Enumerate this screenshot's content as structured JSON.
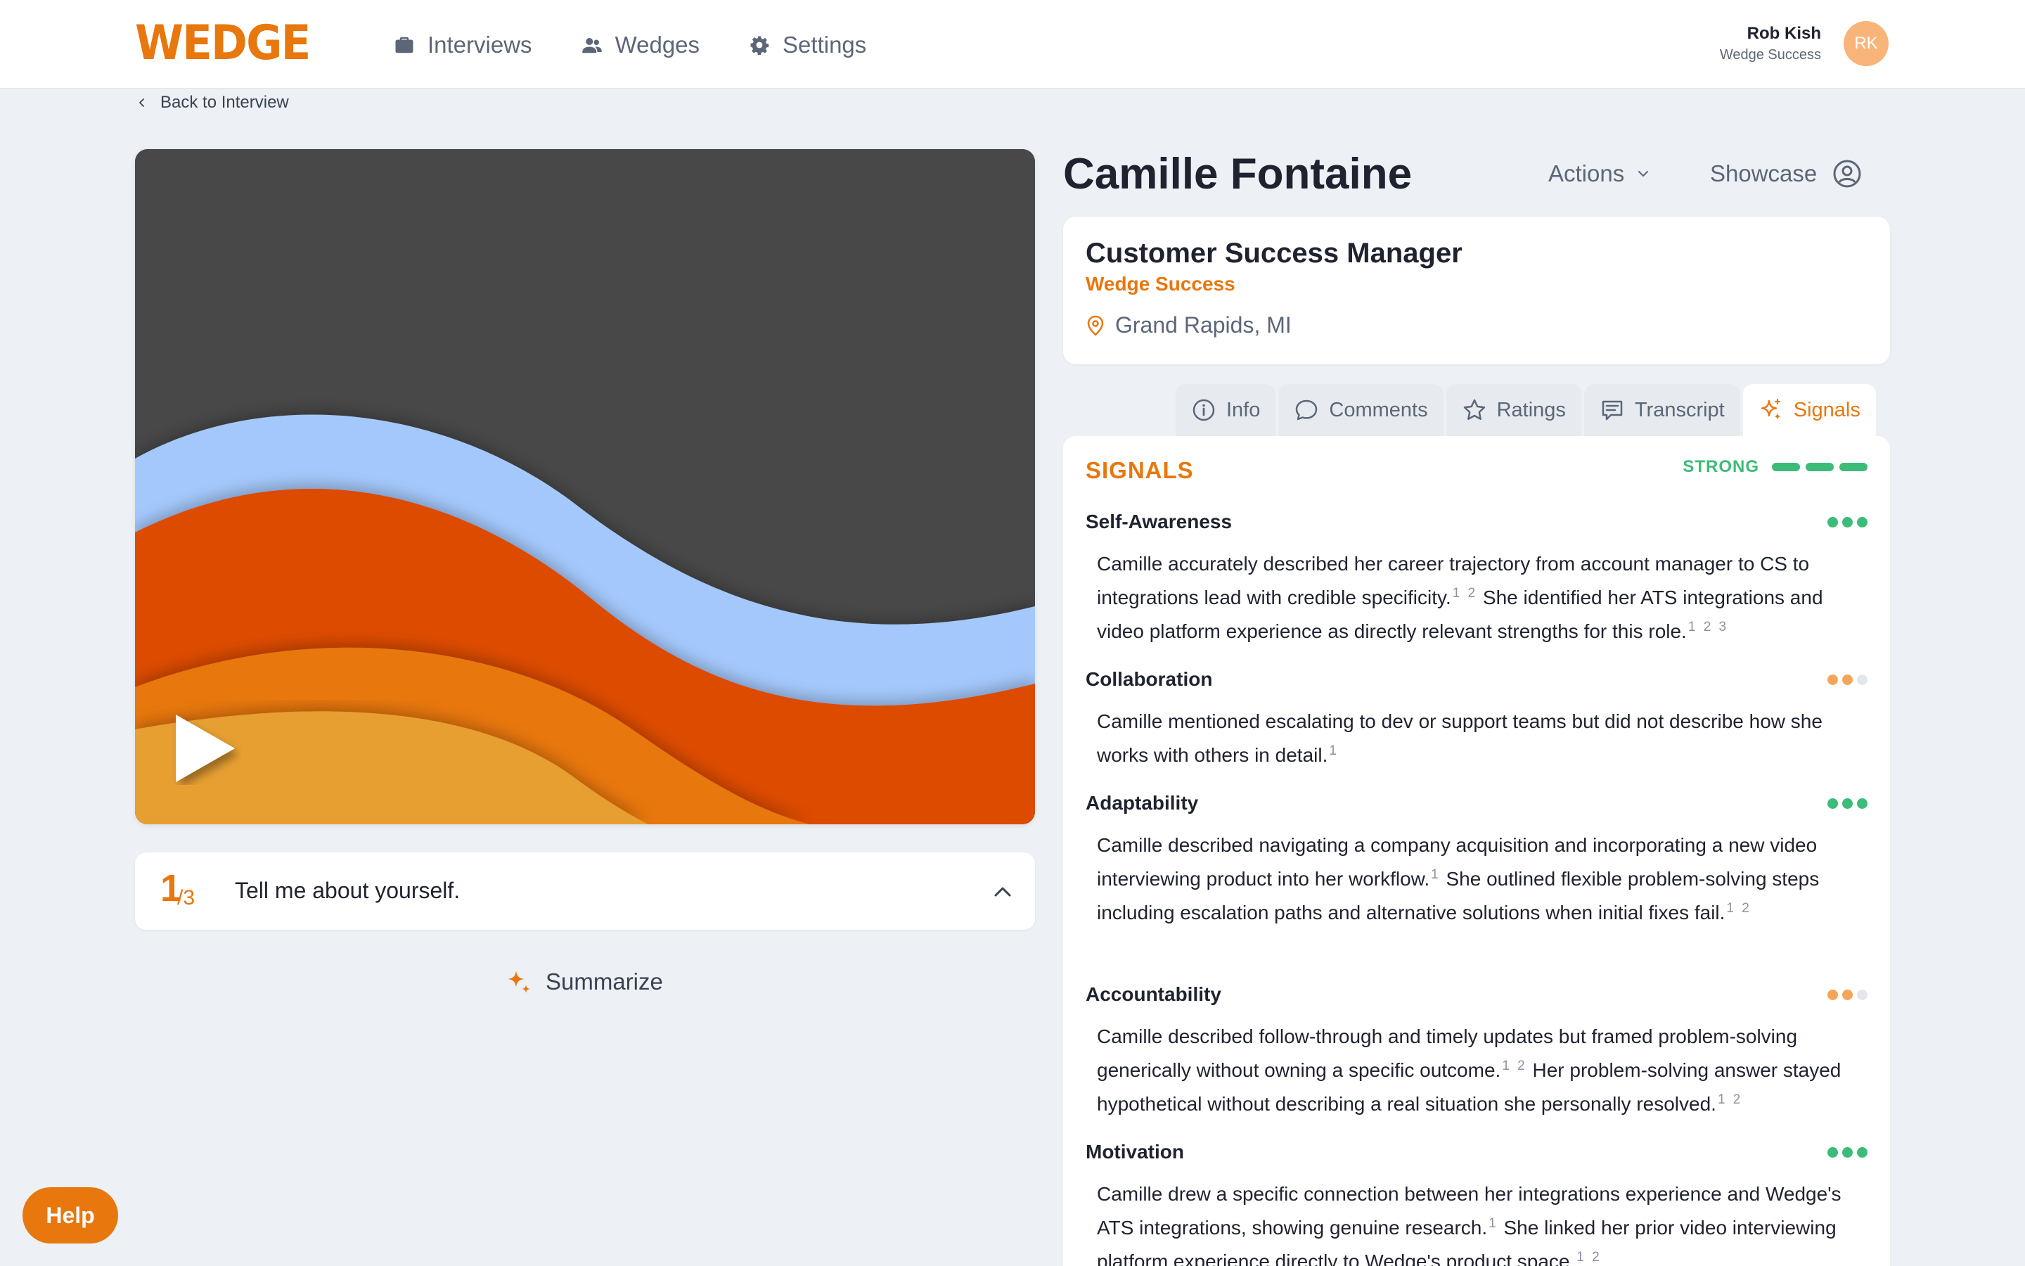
{
  "brand": {
    "logo_text": "WEDGE",
    "accent": "#e8770e",
    "strong_color": "#3dbb79",
    "medium_color": "#f5a55a"
  },
  "nav": {
    "items": [
      {
        "label": "Interviews",
        "icon": "briefcase-icon"
      },
      {
        "label": "Wedges",
        "icon": "users-icon"
      },
      {
        "label": "Settings",
        "icon": "gear-icon"
      }
    ]
  },
  "user": {
    "name": "Rob Kish",
    "org": "Wedge Success",
    "initials": "RK"
  },
  "back_link": "Back to Interview",
  "video": {
    "play_icon": "play-icon"
  },
  "question": {
    "number": "1",
    "total": "/3",
    "text": "Tell me about yourself."
  },
  "summarize_label": "Summarize",
  "candidate": {
    "name": "Camille Fontaine",
    "actions_label": "Actions",
    "showcase_label": "Showcase"
  },
  "job": {
    "title": "Customer Success Manager",
    "company": "Wedge Success",
    "location": "Grand Rapids, MI"
  },
  "tabs": [
    {
      "label": "Info",
      "icon": "info-icon"
    },
    {
      "label": "Comments",
      "icon": "comment-icon"
    },
    {
      "label": "Ratings",
      "icon": "star-icon"
    },
    {
      "label": "Transcript",
      "icon": "transcript-icon"
    },
    {
      "label": "Signals",
      "icon": "sparkle-icon",
      "active": true
    }
  ],
  "signals": {
    "title": "SIGNALS",
    "overall": "STRONG",
    "items": [
      {
        "name": "Self-Awareness",
        "level": 3,
        "parts": [
          {
            "text": "Camille accurately described her career trajectory from account manager to CS to integrations lead with credible specificity.",
            "refs": "1 2"
          },
          {
            "text": " She identified her ATS integrations and video platform experience as directly relevant strengths for this role.",
            "refs": "1 2 3"
          }
        ]
      },
      {
        "name": "Collaboration",
        "level": 2,
        "parts": [
          {
            "text": "Camille mentioned escalating to dev or support teams but did not describe how she works with others in detail.",
            "refs": "1"
          }
        ]
      },
      {
        "name": "Adaptability",
        "level": 3,
        "parts": [
          {
            "text": "Camille described navigating a company acquisition and incorporating a new video interviewing product into her workflow.",
            "refs": "1"
          },
          {
            "text": " She outlined flexible problem-solving steps including escalation paths and alternative solutions when initial fixes fail.",
            "refs": "1 2"
          }
        ]
      },
      {
        "name": "Accountability",
        "level": 2,
        "parts": [
          {
            "text": "Camille described follow-through and timely updates but framed problem-solving generically without owning a specific outcome.",
            "refs": "1 2"
          },
          {
            "text": " Her problem-solving answer stayed hypothetical without describing a real situation she personally resolved.",
            "refs": "1 2"
          }
        ]
      },
      {
        "name": "Motivation",
        "level": 3,
        "parts": [
          {
            "text": "Camille drew a specific connection between her integrations experience and Wedge's ATS integrations, showing genuine research.",
            "refs": "1"
          },
          {
            "text": " She linked her prior video interviewing platform experience directly to Wedge's product space.",
            "refs": "1 2"
          }
        ]
      }
    ]
  },
  "help_label": "Help"
}
